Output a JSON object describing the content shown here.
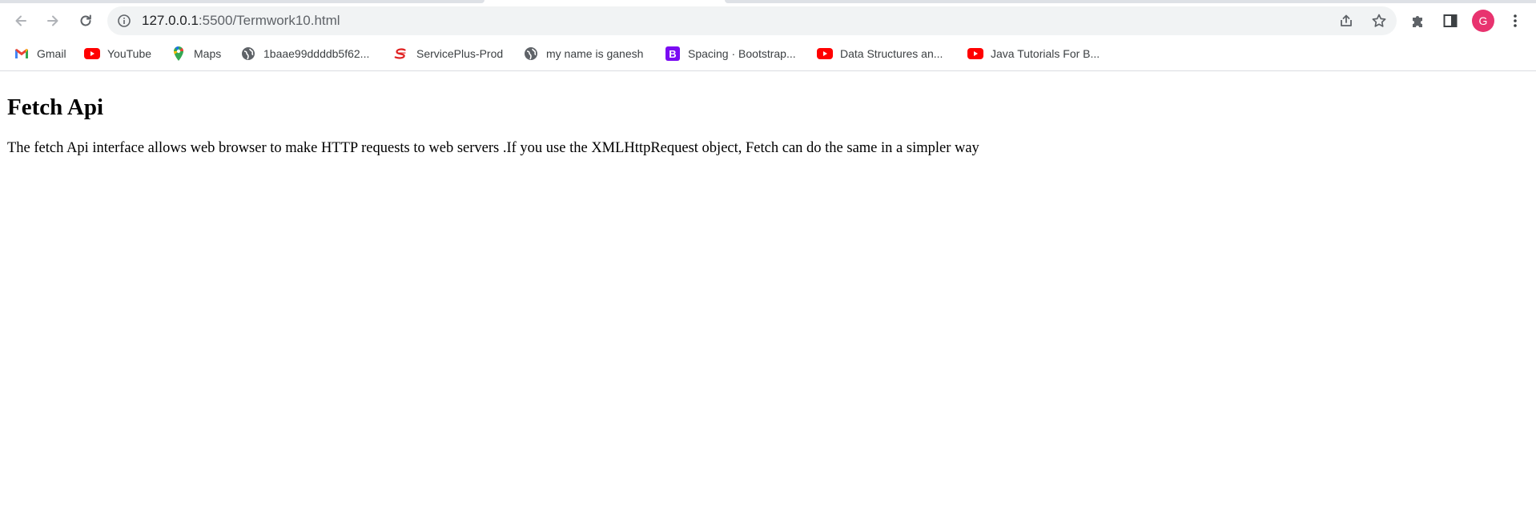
{
  "browser": {
    "url_host": "127.0.0.1",
    "url_rest": ":5500/Termwork10.html",
    "profile_initial": "G"
  },
  "bookmarks": [
    {
      "label": "Gmail",
      "icon": "gmail-icon"
    },
    {
      "label": "YouTube",
      "icon": "youtube-icon"
    },
    {
      "label": "Maps",
      "icon": "maps-icon"
    },
    {
      "label": "1baae99ddddb5f62...",
      "icon": "globe-icon"
    },
    {
      "label": "ServicePlus-Prod",
      "icon": "serviceplus-icon"
    },
    {
      "label": "my name is ganesh",
      "icon": "globe-icon"
    },
    {
      "label": "Spacing · Bootstrap...",
      "icon": "bootstrap-icon"
    },
    {
      "label": "Data Structures an...",
      "icon": "youtube-icon"
    },
    {
      "label": "Java Tutorials For B...",
      "icon": "youtube-icon"
    }
  ],
  "page": {
    "heading": "Fetch Api",
    "paragraph": "The fetch Api interface allows web browser to make HTTP requests to web servers .If you use the XMLHttpRequest object, Fetch can do the same in a simpler way"
  },
  "colors": {
    "youtube": "#ff0000",
    "bootstrap": "#7952b3",
    "avatar": "#e8336f",
    "omnibox_bg": "#f1f3f4"
  }
}
